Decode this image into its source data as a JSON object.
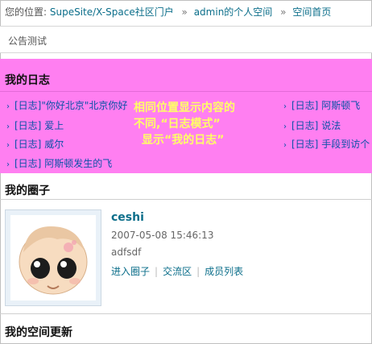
{
  "breadcrumb": {
    "prefix": "您的位置:",
    "items": [
      "SupeSite/X-Space社区门户",
      "admin的个人空间",
      "空间首页"
    ],
    "separator": "»"
  },
  "notice": {
    "text": "公告测试"
  },
  "blog": {
    "title": "我的日志",
    "tag": "[日志]",
    "posts": [
      "\"你好北京\"北京你好",
      "爱上",
      "威尔",
      "阿斯顿发生的飞",
      "阿斯顿飞",
      "说法",
      "手段到访个"
    ],
    "overlay_lines": [
      "相同位置显示内容的",
      "不同,“日志模式”",
      "显示“我的日志”"
    ]
  },
  "circle": {
    "title": "我的圈子",
    "name": "ceshi",
    "date": "2007-05-08 15:46:13",
    "description": "adfsdf",
    "links": [
      "进入圈子",
      "交流区",
      "成员列表"
    ]
  },
  "updates": {
    "title": "我的空间更新"
  },
  "colors": {
    "blog_bg": "#ff7ff1",
    "overlay_text": "#ffff66",
    "link": "#0b6e8a"
  }
}
